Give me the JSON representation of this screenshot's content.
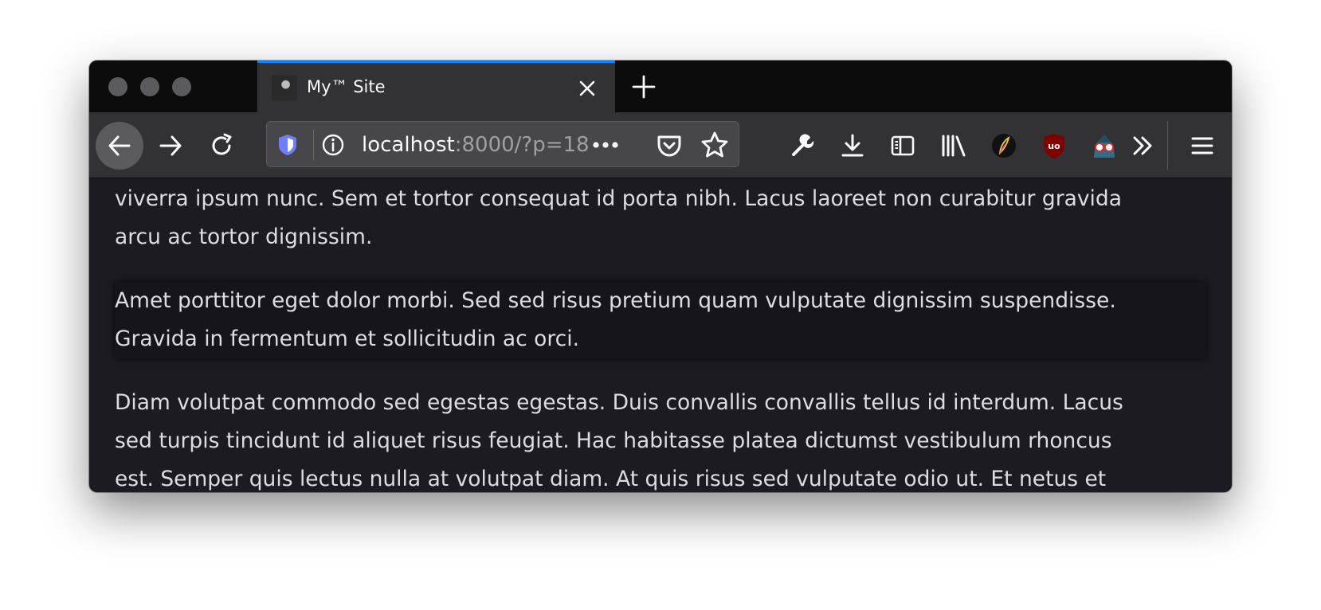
{
  "tab": {
    "title": "My™ Site",
    "favicon": "portrait-favicon"
  },
  "urlbar": {
    "host": "localhost",
    "rest": ":8000/?p=18"
  },
  "content": {
    "p1": "viverra ipsum nunc. Sem et tortor consequat id porta nibh. Lacus laoreet non curabitur gravida\narcu ac tortor dignissim.",
    "p2": "Amet porttitor eget dolor morbi. Sed sed risus pretium quam vulputate dignissim suspendisse.\nGravida in fermentum et sollicitudin ac orci.",
    "p3": "Diam volutpat commodo sed egestas egestas. Duis convallis convallis tellus id interdum. Lacus\nsed turpis tincidunt id aliquet risus feugiat. Hac habitasse platea dictumst vestibulum rhoncus\nest. Semper quis lectus nulla at volutpat diam. At quis risus sed vulputate odio ut. Et netus et"
  },
  "colors": {
    "accent": "#0a84ff",
    "background": "#1c1b22",
    "text": "#dcdce4"
  }
}
